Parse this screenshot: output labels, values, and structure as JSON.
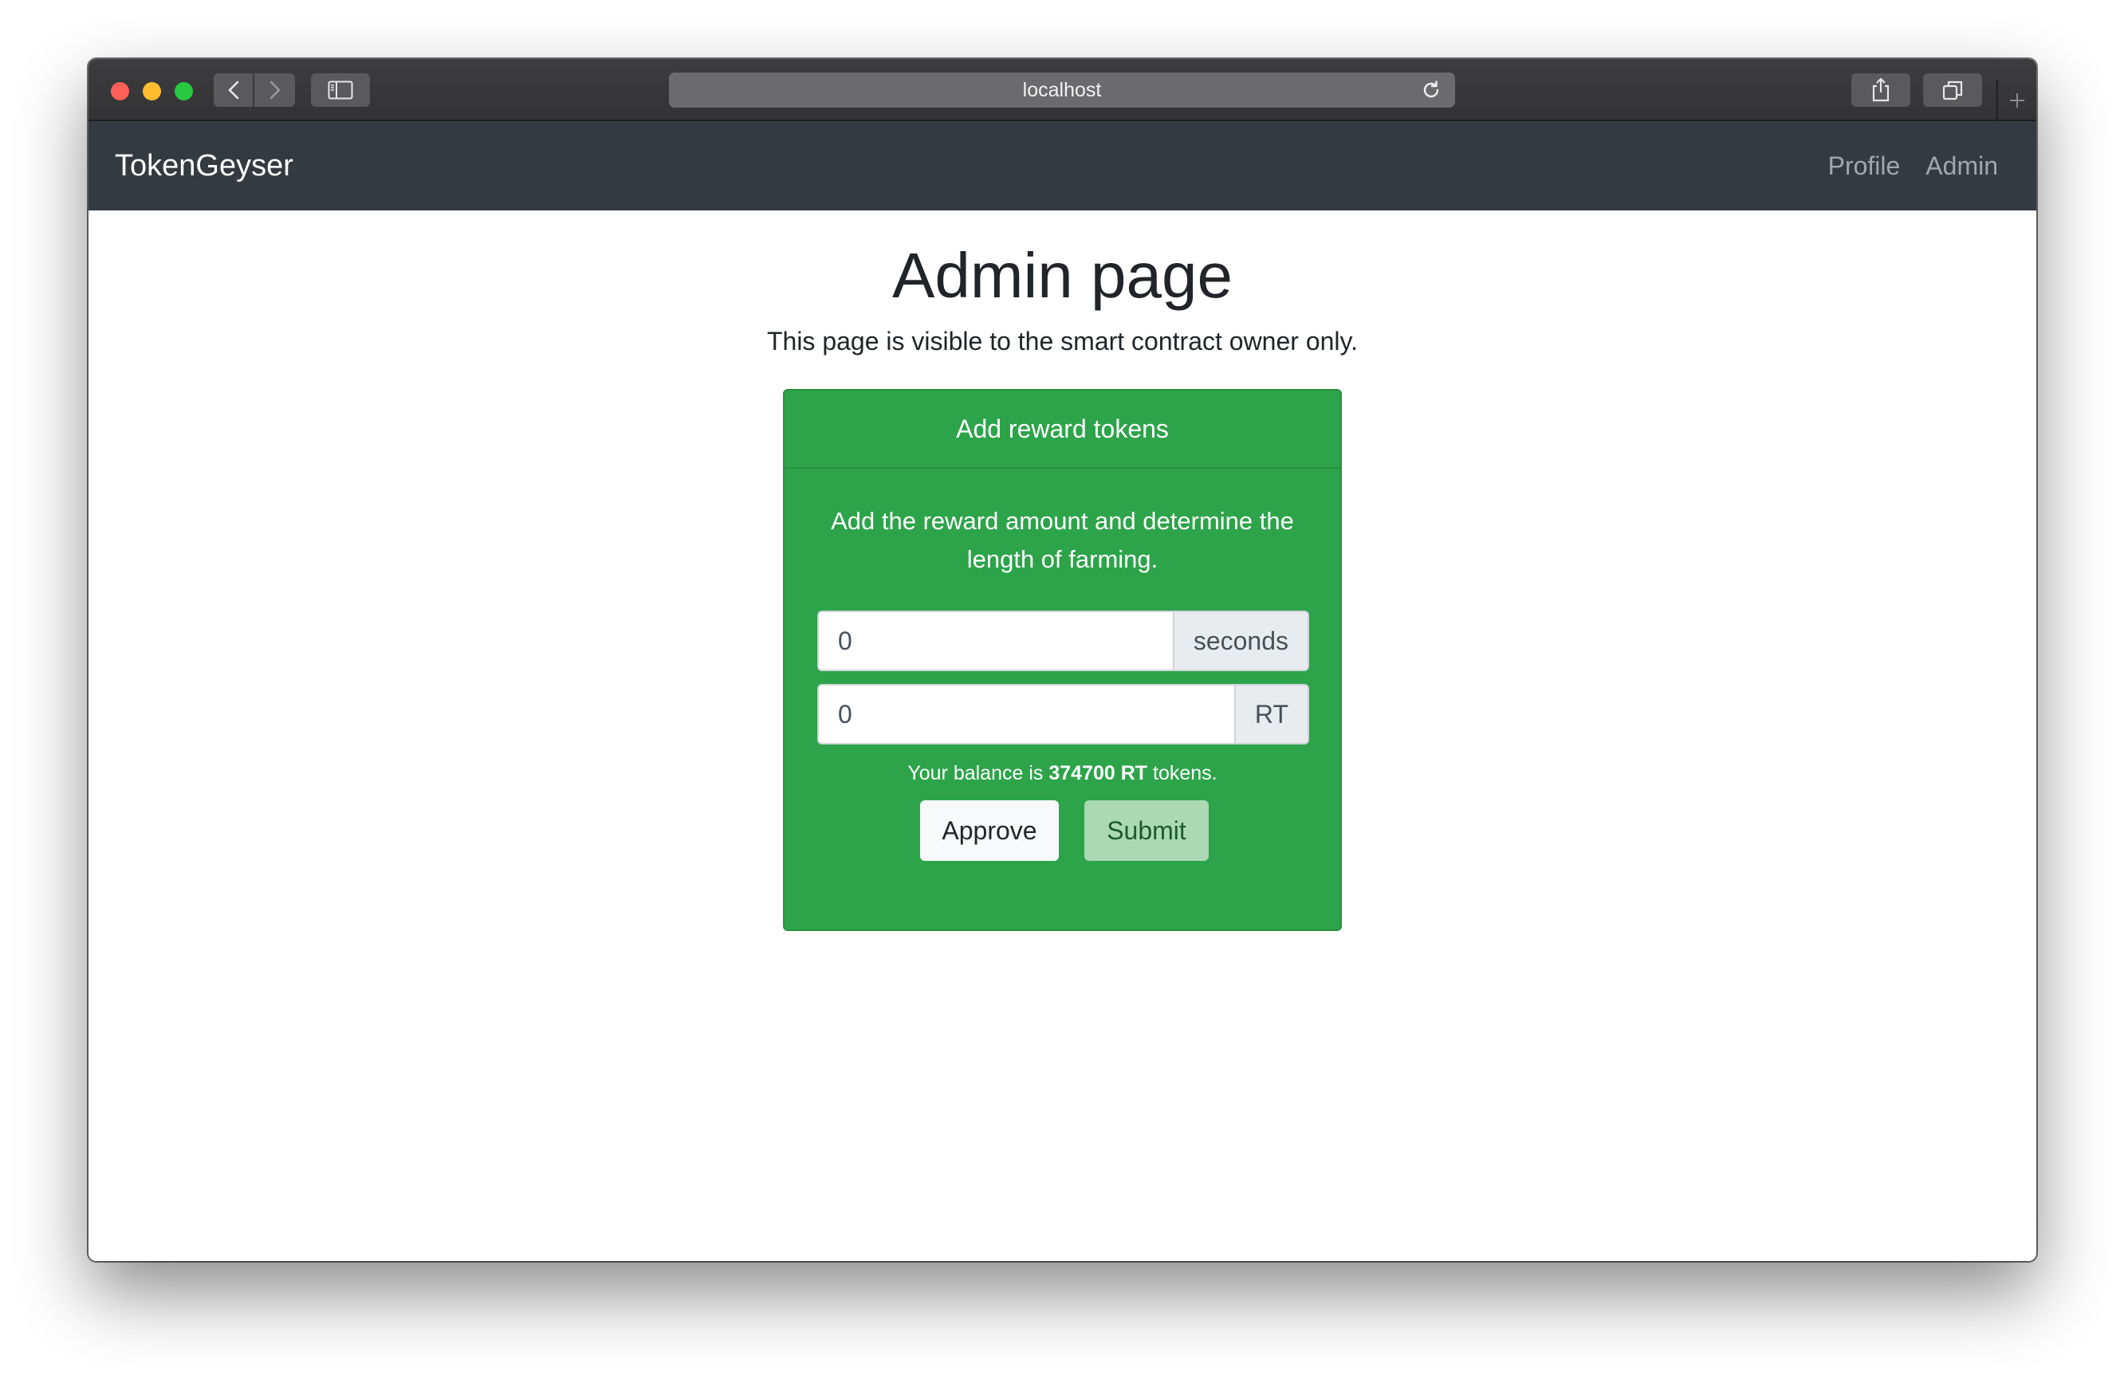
{
  "browser": {
    "url": "localhost",
    "icons": {
      "back": "chevron-left-icon",
      "forward": "chevron-right-icon",
      "sidebar": "sidebar-icon",
      "reload": "reload-icon",
      "share": "share-icon",
      "tabs": "tabs-overview-icon",
      "new_tab": "plus-icon"
    }
  },
  "navbar": {
    "brand": "TokenGeyser",
    "links": [
      "Profile",
      "Admin"
    ],
    "background": "#343a40"
  },
  "page": {
    "title": "Admin page",
    "subtitle": "This page is visible to the smart contract owner only."
  },
  "card": {
    "header": "Add reward tokens",
    "text": "Add the reward amount and determine the length of farming.",
    "duration": {
      "value": "0",
      "unit": "seconds"
    },
    "amount": {
      "value": "0",
      "unit": "RT"
    },
    "balance": {
      "prefix": "Your balance is",
      "amount": "374700 RT",
      "suffix": "tokens."
    },
    "buttons": {
      "approve": "Approve",
      "submit": "Submit"
    },
    "background": "#2da44a"
  }
}
